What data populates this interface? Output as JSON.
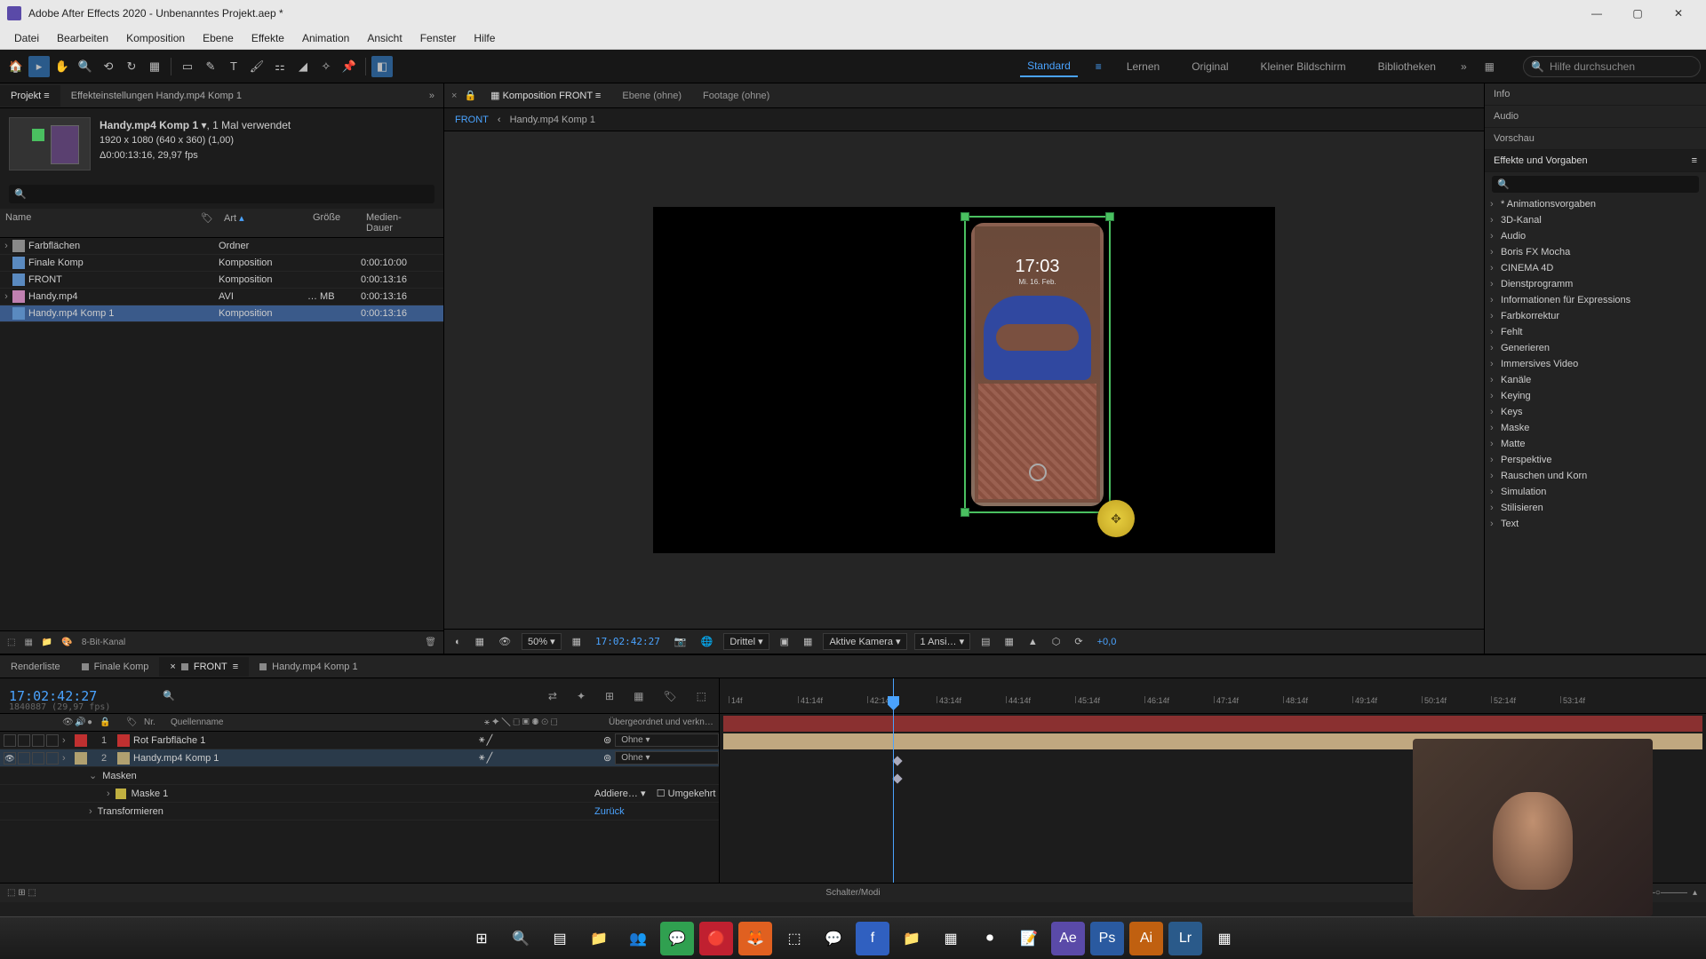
{
  "window": {
    "title": "Adobe After Effects 2020 - Unbenanntes Projekt.aep *"
  },
  "menu": [
    "Datei",
    "Bearbeiten",
    "Komposition",
    "Ebene",
    "Effekte",
    "Animation",
    "Ansicht",
    "Fenster",
    "Hilfe"
  ],
  "workspaces": {
    "items": [
      "Standard",
      "Lernen",
      "Original",
      "Kleiner Bildschirm",
      "Bibliotheken"
    ],
    "active": "Standard",
    "search_placeholder": "Hilfe durchsuchen"
  },
  "project_panel": {
    "tabs": {
      "project": "Projekt",
      "fx": "Effekteinstellungen Handy.mp4 Komp 1"
    },
    "selected": {
      "name": "Handy.mp4 Komp 1",
      "usage": ", 1 Mal verwendet",
      "dims": "1920 x 1080 (640 x 360) (1,00)",
      "dur": "Δ0:00:13:16, 29,97 fps"
    },
    "columns": {
      "name": "Name",
      "type": "Art",
      "size": "Größe",
      "dur": "Medien-Dauer"
    },
    "items": [
      {
        "name": "Farbflächen",
        "type": "Ordner",
        "size": "",
        "dur": "",
        "kind": "folder",
        "caret": "›"
      },
      {
        "name": "Finale Komp",
        "type": "Komposition",
        "size": "",
        "dur": "0:00:10:00",
        "kind": "comp",
        "caret": " "
      },
      {
        "name": "FRONT",
        "type": "Komposition",
        "size": "",
        "dur": "0:00:13:16",
        "kind": "comp",
        "caret": " "
      },
      {
        "name": "Handy.mp4",
        "type": "AVI",
        "size": "… MB",
        "dur": "0:00:13:16",
        "kind": "avi",
        "caret": "›"
      },
      {
        "name": "Handy.mp4 Komp 1",
        "type": "Komposition",
        "size": "",
        "dur": "0:00:13:16",
        "kind": "comp",
        "caret": " ",
        "selected": true
      }
    ],
    "footer_depth": "8-Bit-Kanal"
  },
  "comp_panel": {
    "tabs": {
      "comp": "Komposition FRONT",
      "layer": "Ebene (ohne)",
      "footage": "Footage (ohne)"
    },
    "breadcrumb": [
      "FRONT",
      "‹",
      "Handy.mp4 Komp 1"
    ],
    "phone": {
      "time": "17:03",
      "date": "Mi. 16. Feb."
    },
    "footer": {
      "zoom": "50%",
      "timecode": "17:02:42:27",
      "res": "Drittel",
      "camera": "Aktive Kamera",
      "views": "1 Ansi…",
      "offset": "+0,0"
    }
  },
  "right_panels": {
    "info": "Info",
    "audio": "Audio",
    "preview": "Vorschau",
    "effects": "Effekte und Vorgaben",
    "categories": [
      "* Animationsvorgaben",
      "3D-Kanal",
      "Audio",
      "Boris FX Mocha",
      "CINEMA 4D",
      "Dienstprogramm",
      "Informationen für Expressions",
      "Farbkorrektur",
      "Fehlt",
      "Generieren",
      "Immersives Video",
      "Kanäle",
      "Keying",
      "Keys",
      "Maske",
      "Matte",
      "Perspektive",
      "Rauschen und Korn",
      "Simulation",
      "Stilisieren",
      "Text"
    ]
  },
  "timeline": {
    "tabs": [
      "Renderliste",
      "Finale Komp",
      "FRONT",
      "Handy.mp4 Komp 1"
    ],
    "active_tab": "FRONT",
    "timecode": "17:02:42:27",
    "frames_sub": "1840887 (29,97 fps)",
    "col_nr": "Nr.",
    "col_src": "Quellenname",
    "col_parent": "Übergeordnet und verkn…",
    "layers": [
      {
        "idx": "1",
        "name": "Rot Farbfläche 1",
        "color": "#c03030",
        "parent": "Ohne",
        "vis": false
      },
      {
        "idx": "2",
        "name": "Handy.mp4 Komp 1",
        "color": "#b0a070",
        "parent": "Ohne",
        "vis": true,
        "selected": true
      }
    ],
    "subrows": {
      "masks": "Masken",
      "mask1": "Maske 1",
      "mask_mode": "Addiere…",
      "mask_inv": "Umgekehrt",
      "mask_reset": "Zurück",
      "transform": "Transformieren"
    },
    "ruler_ticks": [
      "14f",
      "41:14f",
      "42:14f",
      "43:14f",
      "44:14f",
      "45:14f",
      "46:14f",
      "47:14f",
      "48:14f",
      "49:14f",
      "50:14f",
      "52:14f",
      "53:14f"
    ],
    "footer_label": "Schalter/Modi"
  },
  "taskbar_icons": [
    "win",
    "search",
    "tasks",
    "explorer",
    "teams",
    "whatsapp",
    "opera",
    "firefox",
    "app1",
    "messenger",
    "facebook",
    "folder",
    "app2",
    "obs",
    "notes",
    "ae",
    "ps",
    "ai",
    "lr",
    "br"
  ]
}
